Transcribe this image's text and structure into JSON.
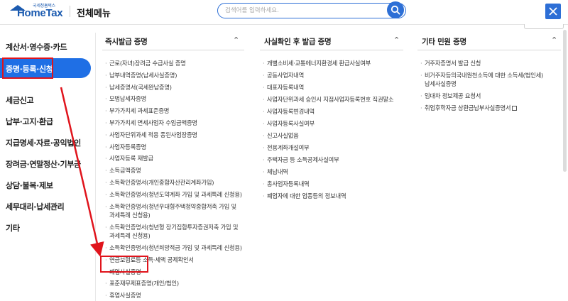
{
  "header": {
    "logo_small": "국세청홈택스",
    "logo_big": "HomeTax",
    "title": "전체메뉴",
    "search_placeholder": "검색어를 입력하세요."
  },
  "sidebar": {
    "items": [
      {
        "label": "계산서·영수증·카드"
      },
      {
        "label": "증명·등록·신청",
        "active": true
      },
      {
        "label": "세금신고"
      },
      {
        "label": "납부·고지·환급"
      },
      {
        "label": "지급명세·자료·공익법인"
      },
      {
        "label": "장려금·연말정산·기부금"
      },
      {
        "label": "상담·불복·제보"
      },
      {
        "label": "세무대리·납세관리"
      },
      {
        "label": "기타"
      }
    ]
  },
  "columns": [
    {
      "title": "즉시발급 증명",
      "items": [
        [
          "근로(자녀)장려금 수급사실 증명"
        ],
        [
          "납부내역증명(납세사실증명)"
        ],
        [
          "납세증명서(국세완납증명)"
        ],
        [
          "모범납세자증명"
        ],
        [
          "부가가치세 과세표준증명"
        ],
        [
          "부가가치세 면세사업자 수입금액증명"
        ],
        [
          "사업자단위과세 적용 종된사업장증명"
        ],
        [
          "사업자등록증명"
        ],
        [
          "사업자등록 재발급"
        ],
        [
          "소득금액증명"
        ],
        [
          "소득확인증명서(개인종합자산관리계좌가입)"
        ],
        [
          "소득확인증명서(청년도약계좌 가입 및 과세특례 신청용)"
        ],
        [
          "소득확인증명서(청년우대형주택청약종합저축 가입 및",
          "과세특례 신청용)"
        ],
        [
          "소득확인증명서(청년형 장기집합투자증권저축 가입 및",
          "과세특례 신청용)"
        ],
        [
          "소득확인증명서(청년희망적금 가입 및 과세특례 신청용)"
        ],
        [
          "연금보험료등 소득·세액 공제확인서"
        ],
        [
          "폐업사실증명"
        ],
        [
          "표준재무제표증명(개인/법인)"
        ],
        [
          "휴업사실증명"
        ]
      ]
    },
    {
      "title": "사실확인 후 발급 증명",
      "items": [
        [
          "개별소비세·교통에너지환경세 환급사실여부"
        ],
        [
          "공동사업자내역"
        ],
        [
          "대표자등록내역"
        ],
        [
          "사업자단위과세 승인시 지점사업자등록번호 직권말소"
        ],
        [
          "사업자등록변경내역"
        ],
        [
          "사업자등록사실여부"
        ],
        [
          "신고사실없음"
        ],
        [
          "전용계좌개설여부"
        ],
        [
          "주택자금 등 소득공제사실여부"
        ],
        [
          "체납내역"
        ],
        [
          "총사업자등록내역"
        ],
        [
          "폐업자에 대한 업종등의 정보내역"
        ]
      ]
    },
    {
      "title": "기타 민원 증명",
      "items": [
        [
          "거주자증명서 발급 신청"
        ],
        [
          "비거주자등의국내원천소득에 대한 소득세(법인세)",
          "납세사실증명"
        ],
        [
          "임대차 정보제공 요청서"
        ],
        [
          "취업후학자금 상환금납부사실증명서"
        ]
      ]
    }
  ],
  "colors": {
    "accent": "#1f6fe5",
    "highlight": "#e0141c",
    "brand": "#1c5bb0"
  },
  "icons": [
    "home-roof-icon",
    "search-icon",
    "close-icon",
    "chevron-up-icon",
    "external-link-icon"
  ]
}
